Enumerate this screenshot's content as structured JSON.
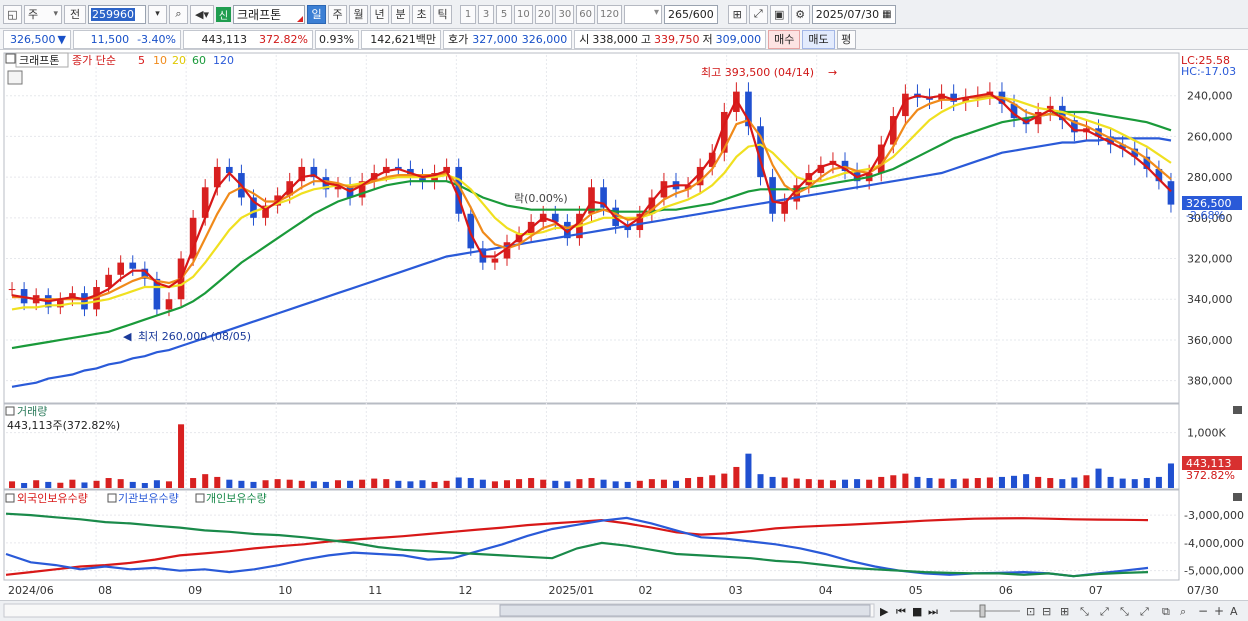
{
  "toolbar": {
    "period_main": "주",
    "prev": "전",
    "code": "259960",
    "name": "크래프톤",
    "badge": "신",
    "periods": [
      "일",
      "주",
      "월",
      "년",
      "분",
      "초",
      "틱"
    ],
    "active_period": "일",
    "intervals": [
      "1",
      "3",
      "5",
      "10",
      "20",
      "30",
      "60",
      "120"
    ],
    "count": "265",
    "count_total": "/600",
    "date": "2025/07/30"
  },
  "quote": {
    "price": "326,500",
    "change": "11,500",
    "change_pct": "-3.40%",
    "volume": "443,113",
    "volume_ratio": "372.82%",
    "turnover": "0.93%",
    "amount": "142,621백만",
    "hoga_label": "호가",
    "ask": "327,000",
    "bid": "326,000",
    "open_label": "시",
    "open": "338,000",
    "high_label": "고",
    "high": "339,750",
    "low_label": "저",
    "low": "309,000",
    "buy_label": "매수",
    "sell_label": "매도",
    "eval_label": "평"
  },
  "price_panel": {
    "title": "크래프톤",
    "legend_prefix": "종가 단순",
    "ma": [
      {
        "period": "5",
        "color": "#d81818"
      },
      {
        "period": "10",
        "color": "#f08a1a"
      },
      {
        "period": "20",
        "color": "#f0e020"
      },
      {
        "period": "60",
        "color": "#1a9a3a"
      },
      {
        "period": "120",
        "color": "#2a5ad8"
      }
    ],
    "lc": "LC:25.58",
    "hc": "HC:-17.03",
    "current": "326,500",
    "current_pct": "-2.68%",
    "y_ticks": [
      "380,000",
      "360,000",
      "340,000",
      "320,000",
      "300,000",
      "280,000",
      "260,000",
      "240,000"
    ],
    "high_annot": "최고 393,500 (04/14)",
    "low_annot": "최저 260,000 (08/05)",
    "mid_annot": "락(0.00%)"
  },
  "volume_panel": {
    "title": "거래량",
    "value": "443,113주(372.82%)",
    "y_tick": "1,000K",
    "current": "443,113",
    "current_pct": "372.82%"
  },
  "holdings_panel": {
    "legend": [
      {
        "label": "외국인보유수량",
        "color": "#d81818"
      },
      {
        "label": "기관보유수량",
        "color": "#2a5ad8"
      },
      {
        "label": "개인보유수량",
        "color": "#1a8a4a"
      }
    ],
    "y_ticks": [
      "-3,000,000",
      "-4,000,000",
      "-5,000,000"
    ]
  },
  "x_axis": {
    "labels": [
      "2024/06",
      "08",
      "09",
      "10",
      "11",
      "12",
      "2025/01",
      "02",
      "03",
      "04",
      "05",
      "06",
      "07"
    ],
    "end_label": "07/30"
  },
  "chart_data": {
    "type": "candlestick",
    "x_start": "2024/06",
    "x_end": "2025/07/30",
    "ylim": [
      230000,
      400000
    ],
    "y_ticks": [
      240000,
      260000,
      280000,
      300000,
      320000,
      340000,
      360000,
      380000
    ],
    "closes": [
      285000,
      278000,
      282000,
      276000,
      280000,
      283000,
      275000,
      286000,
      292000,
      298000,
      295000,
      290000,
      275000,
      280000,
      300000,
      320000,
      335000,
      345000,
      342000,
      330000,
      320000,
      326000,
      331000,
      338000,
      345000,
      340000,
      334000,
      336000,
      330000,
      338000,
      342000,
      345000,
      344000,
      340000,
      338000,
      342000,
      345000,
      322000,
      305000,
      298000,
      300000,
      308000,
      312000,
      318000,
      322000,
      318000,
      310000,
      322000,
      335000,
      325000,
      316000,
      314000,
      322000,
      330000,
      338000,
      334000,
      336000,
      345000,
      352000,
      372000,
      382000,
      365000,
      340000,
      322000,
      328000,
      336000,
      342000,
      346000,
      348000,
      343000,
      338000,
      342000,
      356000,
      370000,
      381000,
      379000,
      378000,
      381000,
      377000,
      379000,
      380000,
      382000,
      376000,
      369000,
      366000,
      372000,
      375000,
      368000,
      362000,
      364000,
      360000,
      356000,
      354000,
      350000,
      344000,
      338000,
      326500
    ],
    "ma_series": [
      {
        "name": "5",
        "values": [
          282000,
          281000,
          280000,
          279000,
          280000,
          281000,
          280000,
          282000,
          285000,
          290000,
          294000,
          294000,
          288000,
          286000,
          290000,
          305000,
          320000,
          335000,
          342000,
          336000,
          328000,
          324000,
          328000,
          334000,
          340000,
          341000,
          337000,
          336000,
          333000,
          336000,
          340000,
          343000,
          344000,
          342000,
          340000,
          341000,
          343000,
          330000,
          312000,
          301000,
          301000,
          305000,
          310000,
          315000,
          320000,
          318000,
          313000,
          318000,
          328000,
          327000,
          320000,
          316000,
          320000,
          328000,
          335000,
          336000,
          336000,
          342000,
          350000,
          366000,
          378000,
          368000,
          348000,
          328000,
          327000,
          334000,
          340000,
          345000,
          347000,
          344000,
          340000,
          342000,
          352000,
          366000,
          378000,
          380000,
          379000,
          380000,
          378000,
          379000,
          380000,
          381000,
          377000,
          371000,
          367000,
          370000,
          373000,
          369000,
          363000,
          363000,
          360000,
          357000,
          354000,
          350000,
          345000,
          339000,
          333000
        ]
      },
      {
        "name": "10",
        "values": [
          281000,
          281000,
          280000,
          280000,
          280000,
          280000,
          280000,
          281000,
          283000,
          286000,
          289000,
          291000,
          289000,
          288000,
          290000,
          298000,
          310000,
          322000,
          332000,
          335000,
          332000,
          328000,
          328000,
          331000,
          335000,
          338000,
          338000,
          337000,
          335000,
          336000,
          338000,
          340000,
          341000,
          341000,
          341000,
          341000,
          342000,
          336000,
          325000,
          313000,
          307000,
          305000,
          307000,
          311000,
          315000,
          317000,
          315000,
          317000,
          322000,
          324000,
          322000,
          319000,
          320000,
          324000,
          329000,
          332000,
          334000,
          338000,
          344000,
          354000,
          366000,
          368000,
          360000,
          346000,
          336000,
          332000,
          335000,
          340000,
          344000,
          345000,
          343000,
          342000,
          346000,
          355000,
          366000,
          373000,
          376000,
          378000,
          378000,
          379000,
          379000,
          380000,
          379000,
          376000,
          372000,
          370000,
          371000,
          370000,
          367000,
          365000,
          362000,
          359000,
          356000,
          353000,
          349000,
          344000,
          339000
        ]
      },
      {
        "name": "20",
        "values": [
          275000,
          276000,
          276000,
          277000,
          277000,
          278000,
          278000,
          279000,
          280000,
          282000,
          284000,
          286000,
          286000,
          286000,
          287000,
          291000,
          298000,
          306000,
          314000,
          320000,
          323000,
          325000,
          327000,
          329000,
          332000,
          334000,
          335000,
          336000,
          336000,
          337000,
          338000,
          339000,
          340000,
          340000,
          340000,
          340000,
          341000,
          339000,
          334000,
          327000,
          320000,
          315000,
          312000,
          312000,
          313000,
          315000,
          315000,
          316000,
          318000,
          320000,
          320000,
          320000,
          320000,
          322000,
          325000,
          327000,
          329000,
          332000,
          336000,
          342000,
          350000,
          355000,
          356000,
          352000,
          346000,
          340000,
          338000,
          338000,
          340000,
          342000,
          343000,
          344000,
          346000,
          350000,
          356000,
          362000,
          368000,
          372000,
          375000,
          377000,
          378000,
          379000,
          379000,
          378000,
          376000,
          374000,
          373000,
          372000,
          370000,
          368000,
          366000,
          364000,
          361000,
          358000,
          355000,
          351000,
          347000
        ]
      },
      {
        "name": "60",
        "values": [
          256000,
          257000,
          258000,
          259000,
          260000,
          261000,
          262000,
          263000,
          264000,
          266000,
          268000,
          270000,
          272000,
          274000,
          276000,
          279000,
          283000,
          288000,
          293000,
          298000,
          302000,
          306000,
          310000,
          314000,
          318000,
          322000,
          325000,
          328000,
          330000,
          332000,
          334000,
          336000,
          337000,
          338000,
          338000,
          338000,
          338000,
          336000,
          333000,
          330000,
          328000,
          326000,
          325000,
          324000,
          324000,
          324000,
          324000,
          324000,
          324000,
          324000,
          323000,
          323000,
          323000,
          323000,
          324000,
          324000,
          325000,
          326000,
          327000,
          329000,
          331000,
          333000,
          334000,
          334000,
          334000,
          334000,
          335000,
          336000,
          337000,
          338000,
          339000,
          340000,
          342000,
          344000,
          347000,
          350000,
          353000,
          356000,
          359000,
          361000,
          363000,
          365000,
          367000,
          368000,
          369000,
          370000,
          371000,
          372000,
          372000,
          372000,
          371000,
          370000,
          369000,
          368000,
          367000,
          365000,
          363000
        ]
      },
      {
        "name": "120",
        "values": [
          237000,
          238000,
          239000,
          241000,
          242000,
          243000,
          245000,
          246000,
          248000,
          249000,
          251000,
          252000,
          254000,
          255000,
          257000,
          259000,
          261000,
          263000,
          265000,
          267000,
          269000,
          271000,
          273000,
          275000,
          277000,
          279000,
          281000,
          283000,
          285000,
          287000,
          289000,
          291000,
          293000,
          295000,
          297000,
          299000,
          301000,
          302000,
          303000,
          304000,
          305000,
          306000,
          307000,
          308000,
          309000,
          310000,
          311000,
          312000,
          313000,
          314000,
          315000,
          316000,
          317000,
          318000,
          319000,
          320000,
          321000,
          322000,
          323000,
          324000,
          325000,
          326000,
          327000,
          328000,
          329000,
          330000,
          331000,
          332000,
          333000,
          334000,
          335000,
          336000,
          337000,
          338000,
          339000,
          340000,
          341000,
          342000,
          344000,
          346000,
          348000,
          350000,
          352000,
          353000,
          354000,
          355000,
          356000,
          357000,
          357000,
          358000,
          358000,
          359000,
          359000,
          359000,
          359000,
          359000,
          358000
        ]
      }
    ],
    "volume_ylim": [
      0,
      1300000
    ],
    "volumes": [
      120000,
      90000,
      140000,
      110000,
      95000,
      150000,
      100000,
      130000,
      180000,
      160000,
      110000,
      90000,
      140000,
      120000,
      1150000,
      180000,
      250000,
      200000,
      150000,
      130000,
      110000,
      140000,
      160000,
      150000,
      130000,
      120000,
      110000,
      140000,
      130000,
      150000,
      170000,
      160000,
      130000,
      120000,
      140000,
      110000,
      130000,
      190000,
      180000,
      150000,
      120000,
      140000,
      160000,
      180000,
      150000,
      130000,
      120000,
      160000,
      180000,
      150000,
      120000,
      110000,
      130000,
      160000,
      150000,
      130000,
      180000,
      200000,
      230000,
      260000,
      380000,
      620000,
      250000,
      200000,
      190000,
      170000,
      160000,
      150000,
      140000,
      150000,
      160000,
      150000,
      200000,
      230000,
      260000,
      200000,
      180000,
      170000,
      160000,
      170000,
      180000,
      190000,
      200000,
      220000,
      250000,
      200000,
      180000,
      160000,
      190000,
      230000,
      350000,
      200000,
      170000,
      160000,
      180000,
      200000,
      443113
    ],
    "holdings_ylim": [
      -5300000,
      -2600000
    ],
    "holdings_series": [
      {
        "name": "외국인보유수량",
        "values": [
          -5150000,
          -5050000,
          -4950000,
          -4850000,
          -4800000,
          -4720000,
          -4600000,
          -4450000,
          -4380000,
          -4300000,
          -4200000,
          -4120000,
          -4050000,
          -3950000,
          -3880000,
          -3820000,
          -3760000,
          -3680000,
          -3600000,
          -3520000,
          -3450000,
          -3360000,
          -3300000,
          -3240000,
          -3180000,
          -3300000,
          -3450000,
          -3620000,
          -3700000,
          -3660000,
          -3580000,
          -3480000,
          -3420000,
          -3380000,
          -3340000,
          -3300000,
          -3250000,
          -3200000,
          -3160000,
          -3130000,
          -3120000,
          -3110000,
          -3130000,
          -3150000,
          -3160000,
          -3170000,
          -3180000
        ]
      },
      {
        "name": "기관보유수량",
        "values": [
          -4400000,
          -4700000,
          -4800000,
          -4950000,
          -4850000,
          -4950000,
          -4900000,
          -5000000,
          -4950000,
          -5050000,
          -4950000,
          -4800000,
          -4600000,
          -4450000,
          -4350000,
          -4400000,
          -4450000,
          -4600000,
          -4550000,
          -4300000,
          -4050000,
          -3750000,
          -3500000,
          -3350000,
          -3200000,
          -3100000,
          -3300000,
          -3550000,
          -3800000,
          -3850000,
          -3950000,
          -4050000,
          -4200000,
          -4400000,
          -4650000,
          -4850000,
          -5000000,
          -5100000,
          -5150000,
          -5100000,
          -5080000,
          -5050000,
          -5100000,
          -5200000,
          -5100000,
          -5000000,
          -4900000
        ]
      },
      {
        "name": "개인보유수량",
        "values": [
          -2950000,
          -3000000,
          -3080000,
          -3150000,
          -3250000,
          -3300000,
          -3380000,
          -3450000,
          -3550000,
          -3600000,
          -3680000,
          -3720000,
          -3800000,
          -3900000,
          -4000000,
          -4150000,
          -4250000,
          -4300000,
          -4350000,
          -4400000,
          -4450000,
          -4500000,
          -4550000,
          -4200000,
          -4000000,
          -4100000,
          -4250000,
          -4400000,
          -4450000,
          -4500000,
          -4550000,
          -4650000,
          -4700000,
          -4800000,
          -4900000,
          -4950000,
          -5000000,
          -5050000,
          -5080000,
          -5100000,
          -5100000,
          -5150000,
          -5100000,
          -5200000,
          -5120000,
          -5080000,
          -5050000
        ]
      }
    ]
  }
}
